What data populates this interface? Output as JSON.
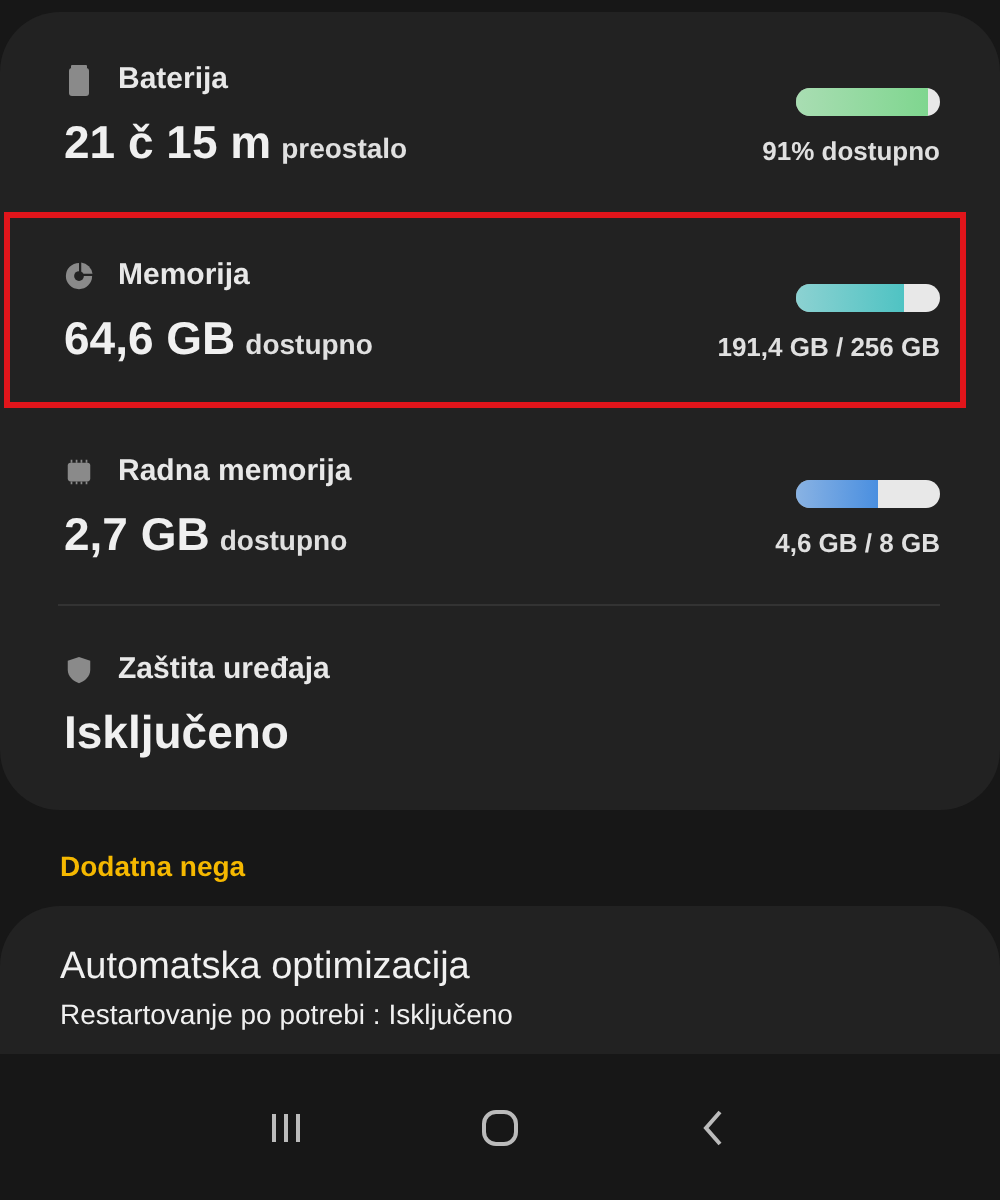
{
  "items": [
    {
      "kind": "meter",
      "title": "Baterija",
      "value": "21 č 15 m",
      "unit": "preostalo",
      "level": 0.91,
      "reading": "91% dostupno",
      "color": "#7fd68f",
      "highlighted": false
    },
    {
      "kind": "meter",
      "title": "Memorija",
      "value": "64,6 GB",
      "unit": "dostupno",
      "level": 0.75,
      "reading": "191,4 GB / 256 GB",
      "color": "#4fc3c3",
      "highlighted": true
    },
    {
      "kind": "meter",
      "title": "Radna memorija",
      "value": "2,7 GB",
      "unit": "dostupno",
      "level": 0.575,
      "reading": "4,6 GB / 8 GB",
      "color": "#4a8fe0",
      "highlighted": false
    },
    {
      "kind": "status",
      "title": "Zaštita uređaja",
      "value": "Isključeno",
      "highlighted": false
    }
  ],
  "section": {
    "title": "Dodatna nega"
  },
  "optimization": {
    "title": "Automatska optimizacija",
    "subtitle": "Restartovanje po potrebi : Isključeno"
  }
}
